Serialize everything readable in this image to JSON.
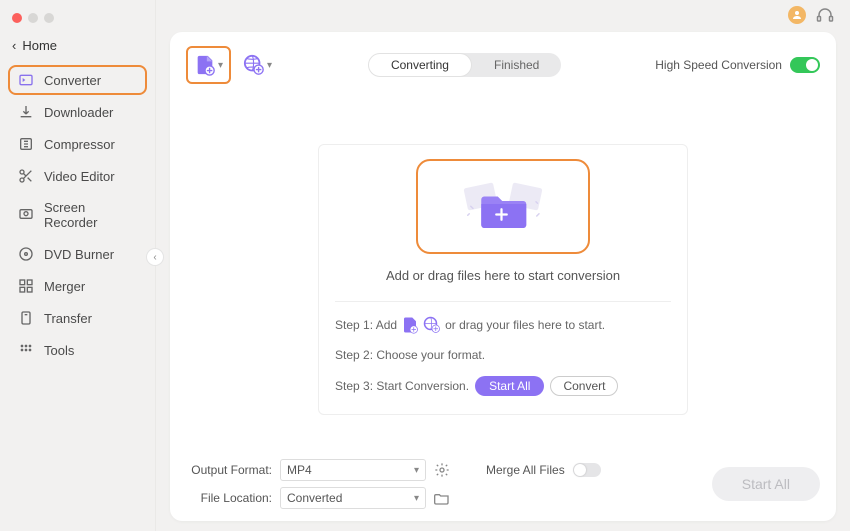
{
  "window": {
    "home": "Home"
  },
  "sidebar": {
    "items": [
      {
        "label": "Converter"
      },
      {
        "label": "Downloader"
      },
      {
        "label": "Compressor"
      },
      {
        "label": "Video Editor"
      },
      {
        "label": "Screen Recorder"
      },
      {
        "label": "DVD Burner"
      },
      {
        "label": "Merger"
      },
      {
        "label": "Transfer"
      },
      {
        "label": "Tools"
      }
    ]
  },
  "tabs": {
    "converting": "Converting",
    "finished": "Finished"
  },
  "toolbar": {
    "highSpeed": "High Speed Conversion"
  },
  "drop": {
    "text": "Add or drag files here to start conversion",
    "step1_pre": "Step 1: Add",
    "step1_post": "or drag your files here to start.",
    "step2": "Step 2: Choose your format.",
    "step3": "Step 3: Start Conversion.",
    "startAll": "Start  All",
    "convert": "Convert"
  },
  "bottom": {
    "outputFormatLabel": "Output Format:",
    "outputFormatValue": "MP4",
    "fileLocationLabel": "File Location:",
    "fileLocationValue": "Converted",
    "mergeLabel": "Merge All Files",
    "startAll": "Start All"
  }
}
